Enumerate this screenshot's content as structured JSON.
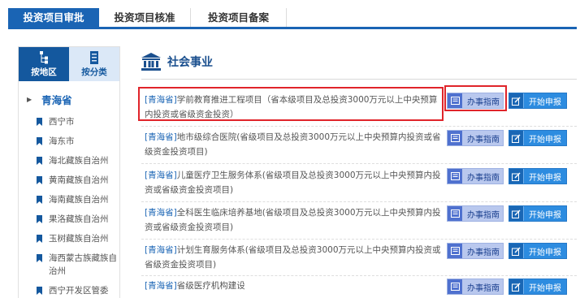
{
  "tabs": [
    {
      "label": "投资项目审批",
      "active": true
    },
    {
      "label": "投资项目核准",
      "active": false
    },
    {
      "label": "投资项目备案",
      "active": false
    }
  ],
  "sidebar": {
    "by_region": "按地区",
    "by_category": "按分类",
    "province": "青海省",
    "cities": [
      "西宁市",
      "海东市",
      "海北藏族自治州",
      "黄南藏族自治州",
      "海南藏族自治州",
      "果洛藏族自治州",
      "玉树藏族自治州",
      "海西蒙古族藏族自治州",
      "西宁开发区管委"
    ]
  },
  "section": {
    "title": "社会事业"
  },
  "items": [
    {
      "tag": "[青海省]",
      "text": "学前教育推进工程项目（省本级项目及总投资3000万元以上中央预算内投资或省级资金投资）"
    },
    {
      "tag": "[青海省]",
      "text": "地市级综合医院(省级项目及总投资3000万元以上中央预算内投资或省级资金投资项目)"
    },
    {
      "tag": "[青海省]",
      "text": "儿童医疗卫生服务体系(省级项目及总投资3000万元以上中央预算内投资或省级资金投资项目)"
    },
    {
      "tag": "[青海省]",
      "text": "全科医生临床培养基地(省级项目及总投资3000万元以上中央预算内投资或省级资金投资项目)"
    },
    {
      "tag": "[青海省]",
      "text": "计划生育服务体系(省级项目及总投资3000万元以上中央预算内投资或省级资金投资项目)"
    },
    {
      "tag": "[青海省]",
      "text": "省级医疗机构建设"
    }
  ],
  "buttons": {
    "guide": "办事指南",
    "apply": "开始申报"
  },
  "colors": {
    "primary": "#1a64b4",
    "highlight": "#e0242a"
  }
}
